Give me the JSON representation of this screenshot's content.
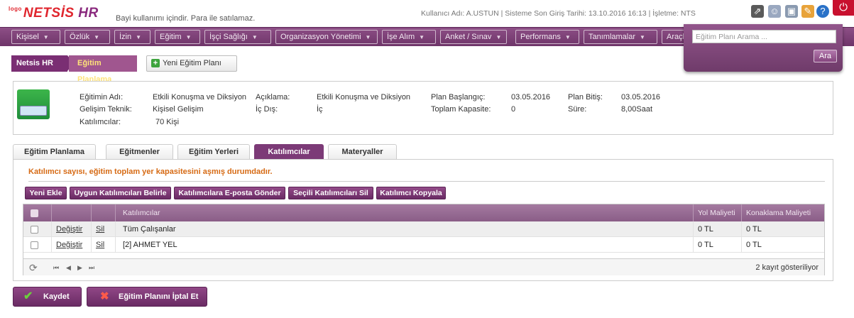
{
  "header": {
    "logo_small": "logo",
    "logo_main": "NETSİS",
    "logo_hr": "HR",
    "tagline": "Bayi kullanımı içindir. Para ile satılamaz.",
    "user_info": "Kullanıcı Adı: A.USTUN | Sisteme Son Giriş Tarihi: 13.10.2016 16:13 | İşletme: NTS",
    "icons": [
      "external-link-icon",
      "users-icon",
      "monitor-icon",
      "key-icon",
      "help-icon",
      "power-icon"
    ]
  },
  "menu": {
    "items": [
      {
        "label": "Kişisel"
      },
      {
        "label": "Özlük"
      },
      {
        "label": "İzin"
      },
      {
        "label": "Eğitim"
      },
      {
        "label": "İşçi Sağlığı"
      },
      {
        "label": "Organizasyon Yönetimi"
      },
      {
        "label": "İşe Alım"
      },
      {
        "label": "Anket / Sınav"
      },
      {
        "label": "Performans"
      },
      {
        "label": "Tanımlamalar"
      },
      {
        "label": "Araçl"
      }
    ]
  },
  "search": {
    "placeholder": "Eğitim Planı Arama ...",
    "button": "Ara"
  },
  "breadcrumb": {
    "root": "Netsis HR",
    "current": "Eğitim Planlama"
  },
  "new_plan_button": "Yeni Eğitim Planı",
  "info": {
    "name_label": "Eğitimin Adı:",
    "name_value": "Etkili Konuşma ve Diksiyon",
    "technique_label": "Gelişim Teknik:",
    "technique_value": "Kişisel Gelişim",
    "participants_label": "Katılımcılar:",
    "participants_value": "70 Kişi",
    "desc_label": "Açıklama:",
    "desc_value": "Etkili Konuşma ve Diksiyon",
    "inout_label": "İç Dış:",
    "inout_value": "İç",
    "start_label": "Plan Başlangıç:",
    "start_value": "03.05.2016",
    "capacity_label": "Toplam Kapasite:",
    "capacity_value": "0",
    "end_label": "Plan Bitiş:",
    "end_value": "03.05.2016",
    "duration_label": "Süre:",
    "duration_value": "8,00Saat"
  },
  "tabs": [
    {
      "label": "Eğitim Planlama"
    },
    {
      "label": "Eğitmenler"
    },
    {
      "label": "Eğitim Yerleri"
    },
    {
      "label": "Katılımcılar",
      "active": true
    },
    {
      "label": "Materyaller"
    }
  ],
  "warning": "Katılımcı sayısı, eğitim toplam yer kapasitesini aşmış durumdadır.",
  "actions": {
    "add": "Yeni Ekle",
    "determine": "Uygun Katılımcıları Belirle",
    "email": "Katılımcılara E-posta Gönder",
    "delete_selected": "Seçili Katılımcıları Sil",
    "copy": "Katılımcı Kopyala"
  },
  "grid": {
    "columns": {
      "participants": "Katılımcılar",
      "travel": "Yol Maliyeti",
      "lodging": "Konaklama Maliyeti"
    },
    "rows": [
      {
        "edit": "Değiştir",
        "delete": "Sil",
        "name": "Tüm Çalışanlar",
        "travel": "0 TL",
        "lodging": "0 TL"
      },
      {
        "edit": "Değiştir",
        "delete": "Sil",
        "name": "[2] AHMET YEL",
        "travel": "0 TL",
        "lodging": "0 TL"
      }
    ],
    "record_count": "2 kayıt gösteriliyor"
  },
  "footer": {
    "save": "Kaydet",
    "cancel": "Eğitim Planını İptal Et"
  },
  "colors": {
    "brand": "#7c3a77",
    "warning": "#d66a14",
    "logo": "#e0262e"
  }
}
